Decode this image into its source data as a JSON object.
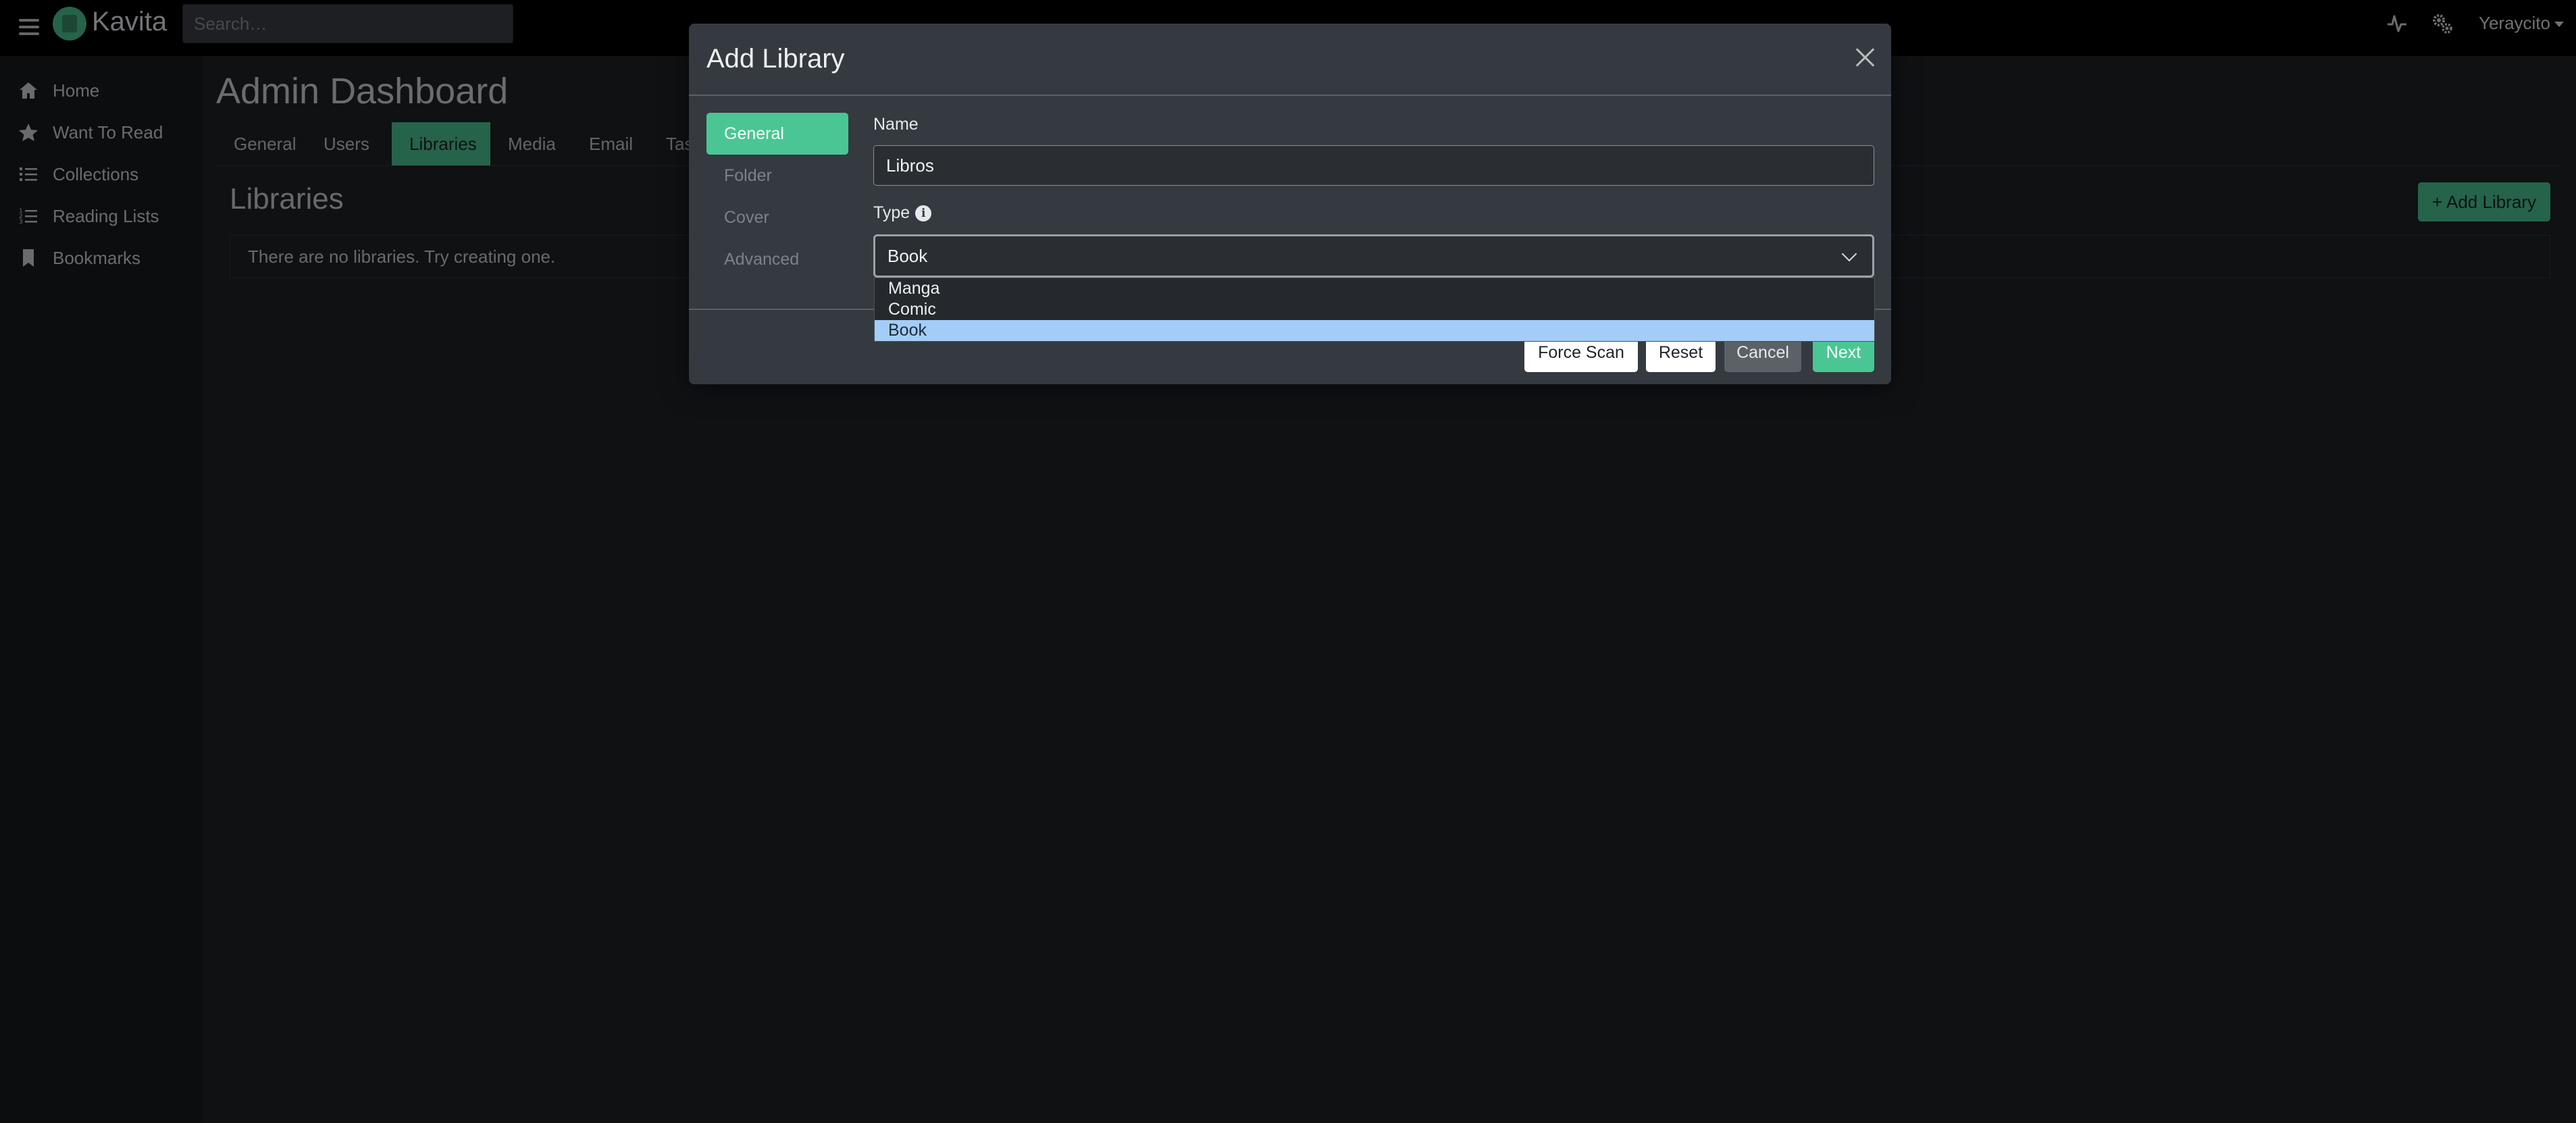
{
  "app": {
    "name": "Kavita"
  },
  "header": {
    "search_placeholder": "Search…",
    "user_name": "Yeraycito",
    "icons": [
      "activity-icon",
      "settings-icon"
    ]
  },
  "sidebar": {
    "items": [
      {
        "label": "Home",
        "icon": "home-icon"
      },
      {
        "label": "Want To Read",
        "icon": "star-icon"
      },
      {
        "label": "Collections",
        "icon": "list-icon"
      },
      {
        "label": "Reading Lists",
        "icon": "list-ordered-icon"
      },
      {
        "label": "Bookmarks",
        "icon": "bookmark-icon"
      }
    ]
  },
  "main": {
    "title": "Admin Dashboard",
    "tabs": [
      {
        "label": "General"
      },
      {
        "label": "Users"
      },
      {
        "label": "Libraries",
        "active": true
      },
      {
        "label": "Media"
      },
      {
        "label": "Email"
      },
      {
        "label": "Tasks"
      }
    ],
    "section_title": "Libraries",
    "add_library_label": "Add Library",
    "empty_message": "There are no libraries. Try creating one."
  },
  "modal": {
    "title": "Add Library",
    "nav": [
      {
        "label": "General",
        "active": true
      },
      {
        "label": "Folder"
      },
      {
        "label": "Cover"
      },
      {
        "label": "Advanced"
      }
    ],
    "name_label": "Name",
    "name_value": "Libros",
    "type_label": "Type",
    "type_value": "Book",
    "type_options": [
      "Manga",
      "Comic",
      "Book"
    ],
    "buttons": {
      "force_scan": "Force Scan",
      "reset": "Reset",
      "cancel": "Cancel",
      "next": "Next"
    }
  },
  "colors": {
    "accent": "#4ac694",
    "background": "#1f2226",
    "modal_bg": "#343a40",
    "selected_option": "#a3cdf8"
  }
}
